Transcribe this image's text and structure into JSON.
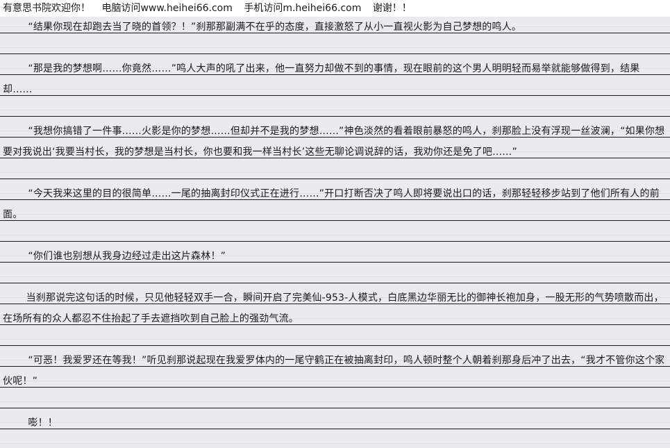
{
  "banner": {
    "welcome": "有意思书院欢迎你！",
    "pc_visit": "电脑访问www.heihei66.com",
    "mobile_visit": "手机访问m.heihei66.com",
    "thanks": "谢谢！！"
  },
  "paragraphs": [
    "“结果你现在却跑去当了晓的首领？！”刹那那副满不在乎的态度，直接激怒了从小一直视火影为自己梦想的鸣人。",
    "“那是我的梦想啊……你竟然……”鸣人大声的吼了出来，他一直努力却做不到的事情，现在眼前的这个男人明明轻而易举就能够做得到，结果却……",
    "“我想你搞错了一件事……火影是你的梦想……但却并不是我的梦想……”神色淡然的看着眼前暴怒的鸣人，刹那脸上没有浮现一丝波澜，“如果你想要对我说出‘我要当村长，我的梦想是当村长，你也要和我一样当村长’这些无聊论调说辞的话，我劝你还是免了吧……”",
    "“今天我来这里的目的很简单……一尾的抽离封印仪式正在进行……”开口打断否决了鸣人即将要说出口的话，刹那轻轻移步站到了他们所有人的前面。",
    "“你们谁也别想从我身边经过走出这片森林！”",
    "当刹那说完这句话的时候，只见他轻轻双手一合，瞬间开启了完美仙-953-人模式，白底黑边华丽无比的御神长袍加身，一股无形的气势喷散而出，在场所有的众人都忍不住抬起了手去遮挡吹到自己脸上的强劲气流。",
    "“可恶！我爱罗还在等我！”听见刹那说起现在我爱罗体内的一尾守鹤正在被抽离封印，鸣人顿时整个人朝着刹那身后冲了出去，“我才不管你这个家伙呢！”",
    "嘭！！"
  ]
}
